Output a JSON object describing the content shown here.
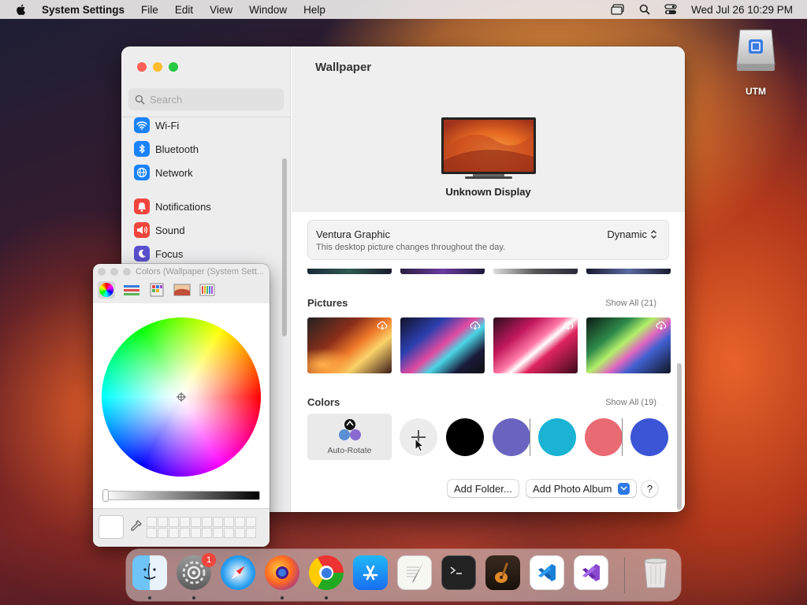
{
  "menubar": {
    "app_name": "System Settings",
    "items": [
      "File",
      "Edit",
      "View",
      "Window",
      "Help"
    ],
    "clock": "Wed Jul 26  10:29 PM",
    "status_icons": [
      "screen-mirroring-icon",
      "search-icon",
      "control-center-icon"
    ]
  },
  "desktop": {
    "drive_label": "UTM"
  },
  "settings": {
    "search_placeholder": "Search",
    "sidebar": {
      "items": [
        {
          "label": "Wi-Fi",
          "icon": "wifi-icon",
          "color": "#1a82fb"
        },
        {
          "label": "Bluetooth",
          "icon": "bluetooth-icon",
          "color": "#1a82fb"
        },
        {
          "label": "Network",
          "icon": "globe-icon",
          "color": "#1a82fb"
        },
        {
          "label": "Notifications",
          "icon": "bell-icon",
          "color": "#f0453c"
        },
        {
          "label": "Sound",
          "icon": "speaker-icon",
          "color": "#f0453c"
        },
        {
          "label": "Focus",
          "icon": "moon-icon",
          "color": "#5a4fcf"
        }
      ]
    },
    "main": {
      "title": "Wallpaper",
      "display_name": "Unknown Display",
      "current_wallpaper": {
        "name": "Ventura Graphic",
        "description": "This desktop picture changes throughout the day.",
        "mode": "Dynamic"
      },
      "pictures": {
        "title": "Pictures",
        "show_all": "Show All (21)"
      },
      "colors": {
        "title": "Colors",
        "show_all": "Show All (19)",
        "auto_rotate_label": "Auto-Rotate",
        "swatches": [
          "#000000",
          "#6a64c0",
          "#1ab3d4",
          "#e96a72",
          "#3b55d6"
        ]
      },
      "buttons": {
        "add_folder": "Add Folder...",
        "add_photo_album": "Add Photo Album",
        "help": "?"
      }
    }
  },
  "colors_panel": {
    "title": "Colors (Wallpaper (System Sett...",
    "tools": [
      "color-wheel-icon",
      "sliders-icon",
      "palettes-icon",
      "image-palettes-icon",
      "pencils-icon"
    ]
  },
  "dock": {
    "apps": [
      "Finder",
      "System Settings",
      "Safari",
      "Firefox",
      "Chrome",
      "App Store",
      "TextEdit",
      "Terminal",
      "GarageBand",
      "VS Code",
      "Visual Studio",
      "Trash"
    ],
    "settings_badge": "1"
  },
  "accent_color": "#2e78e6"
}
